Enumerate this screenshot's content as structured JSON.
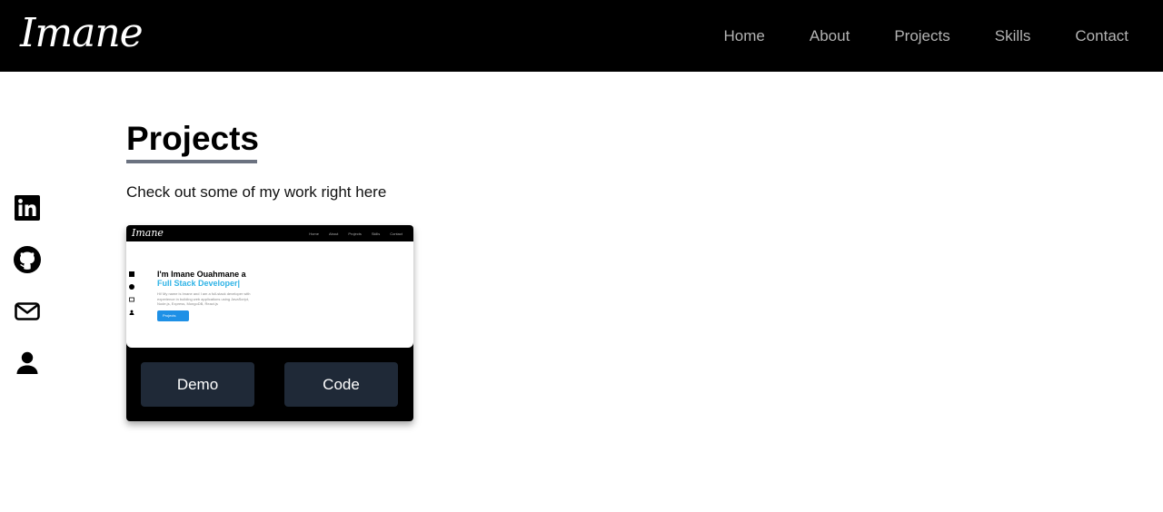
{
  "header": {
    "logo": "Imane",
    "nav": [
      "Home",
      "About",
      "Projects",
      "Skills",
      "Contact"
    ]
  },
  "social": {
    "icons": [
      "linkedin-icon",
      "github-icon",
      "mail-icon",
      "person-icon"
    ]
  },
  "section": {
    "title": "Projects",
    "subtitle": "Check out some of my work right here"
  },
  "project": {
    "thumbnail": {
      "logo": "Imane",
      "nav": [
        "Home",
        "About",
        "Projects",
        "Skills",
        "Contact"
      ],
      "heading": "I'm Imane Ouahmane a",
      "role": "Full Stack Developer|",
      "intro": "Hi! My name is Imane and I am a full-stack developer with experience in building web applications using JavaScript, Node.js, Express, MongoDB, React.js",
      "button": "Projects"
    },
    "demo_label": "Demo",
    "code_label": "Code"
  },
  "colors": {
    "header_bg": "#000000",
    "nav_text": "#b3b3b3",
    "button_bg": "#1f2937",
    "accent": "#2fb3e6"
  }
}
